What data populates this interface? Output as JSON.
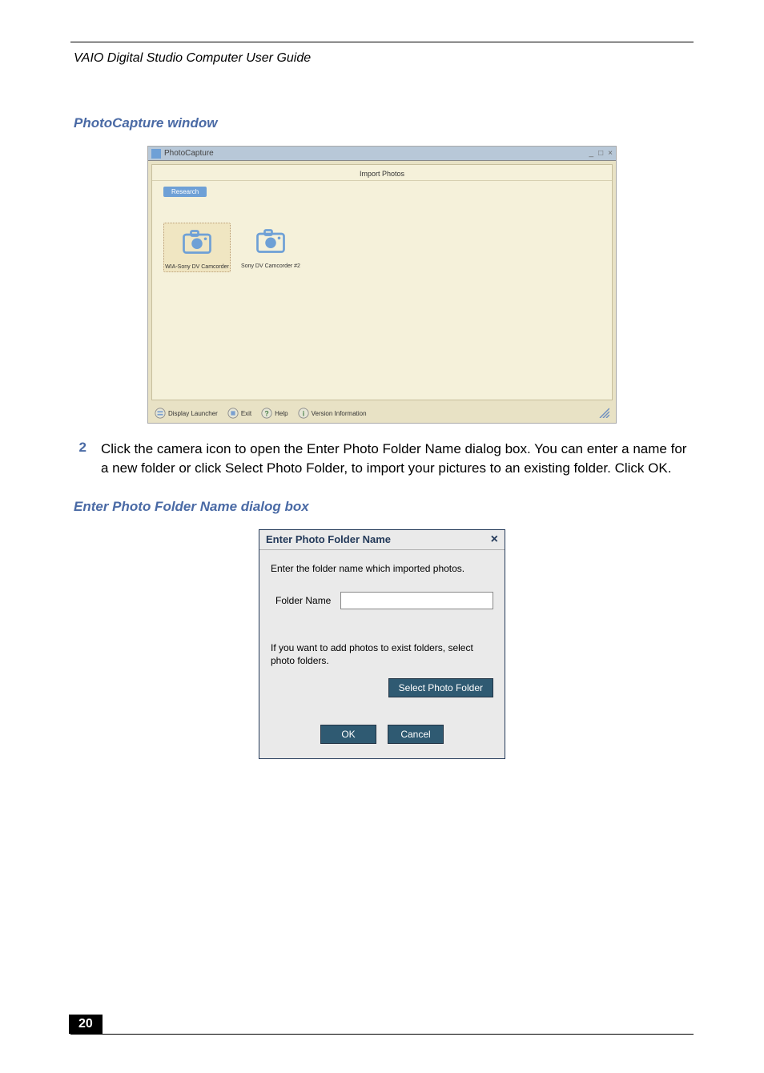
{
  "running_head": "VAIO Digital Studio Computer User Guide",
  "page_number": "20",
  "sections": {
    "photocapture_heading": "PhotoCapture window",
    "dialog_heading": "Enter Photo Folder Name dialog box"
  },
  "step": {
    "num": "2",
    "text": "Click the camera icon to open the Enter Photo Folder Name dialog box. You can enter a name for a new folder or click Select Photo Folder, to import your pictures to an existing folder. Click OK."
  },
  "photocapture": {
    "title": "PhotoCapture",
    "panel_title": "Import Photos",
    "tab_label": "Research",
    "devices": [
      {
        "label": "WIA-Sony DV Camcorder"
      },
      {
        "label": "Sony DV Camcorder #2"
      }
    ],
    "status": {
      "launcher": "Display Launcher",
      "exit": "Exit",
      "help": "Help",
      "version": "Version Information"
    }
  },
  "dialog": {
    "title": "Enter Photo Folder Name",
    "instruction": "Enter the folder name which imported photos.",
    "folder_label": "Folder Name",
    "instruction2": "If you want to add photos to exist folders, select photo folders.",
    "select_btn": "Select Photo Folder",
    "ok": "OK",
    "cancel": "Cancel"
  }
}
